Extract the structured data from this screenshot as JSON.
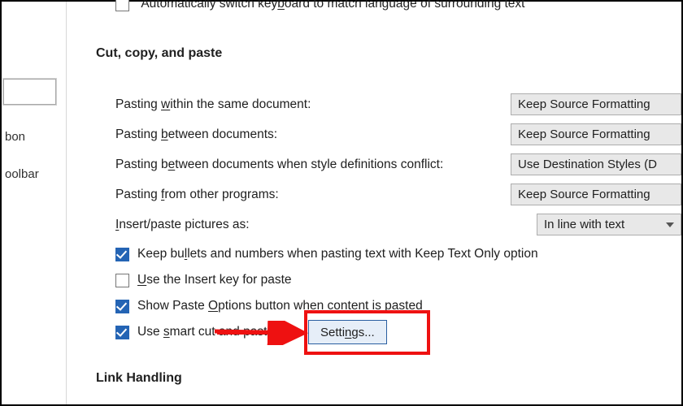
{
  "top_row": {
    "auto_switch_keyboard": "Automatically switch keyboard to match language of surrounding text",
    "auto_switch_keyboard_ul": "b"
  },
  "leftnav": {
    "item_ribbon": "bon",
    "item_toolbar": "oolbar"
  },
  "sections": {
    "cut_copy_paste": "Cut, copy, and paste",
    "link_handling": "Link Handling"
  },
  "paste_rows": [
    {
      "label_pre": "Pasting ",
      "ul": "w",
      "label_post": "ithin the same document:",
      "value": "Keep Source Formatting"
    },
    {
      "label_pre": "Pasting ",
      "ul": "b",
      "label_post": "etween documents:",
      "value": "Keep Source Formatting"
    },
    {
      "label_pre": "Pasting b",
      "ul": "e",
      "label_post": "tween documents when style definitions conflict:",
      "value": "Use Destination Styles (D"
    },
    {
      "label_pre": "Pasting ",
      "ul": "f",
      "label_post": "rom other programs:",
      "value": "Keep Source Formatting"
    },
    {
      "label_pre": "",
      "ul": "I",
      "label_post": "nsert/paste pictures as:",
      "value": "In line with text",
      "narrow": true
    }
  ],
  "checkboxes": {
    "keep_bullets": {
      "pre": "Keep bu",
      "ul": "l",
      "post": "lets and numbers when pasting text with Keep Text Only option",
      "checked": true
    },
    "insert_key": {
      "pre": "",
      "ul": "U",
      "post": "se the Insert key for paste",
      "checked": false
    },
    "paste_options": {
      "pre": "Show Paste ",
      "ul": "O",
      "post": "ptions button when content is pasted",
      "checked": true
    },
    "smart_cut": {
      "pre": "Use ",
      "ul": "s",
      "mid": "mart cut ",
      "strike": "and paste",
      "checked": true
    }
  },
  "buttons": {
    "settings_pre": "Setti",
    "settings_ul": "n",
    "settings_post": "gs..."
  },
  "info_glyph": "i"
}
